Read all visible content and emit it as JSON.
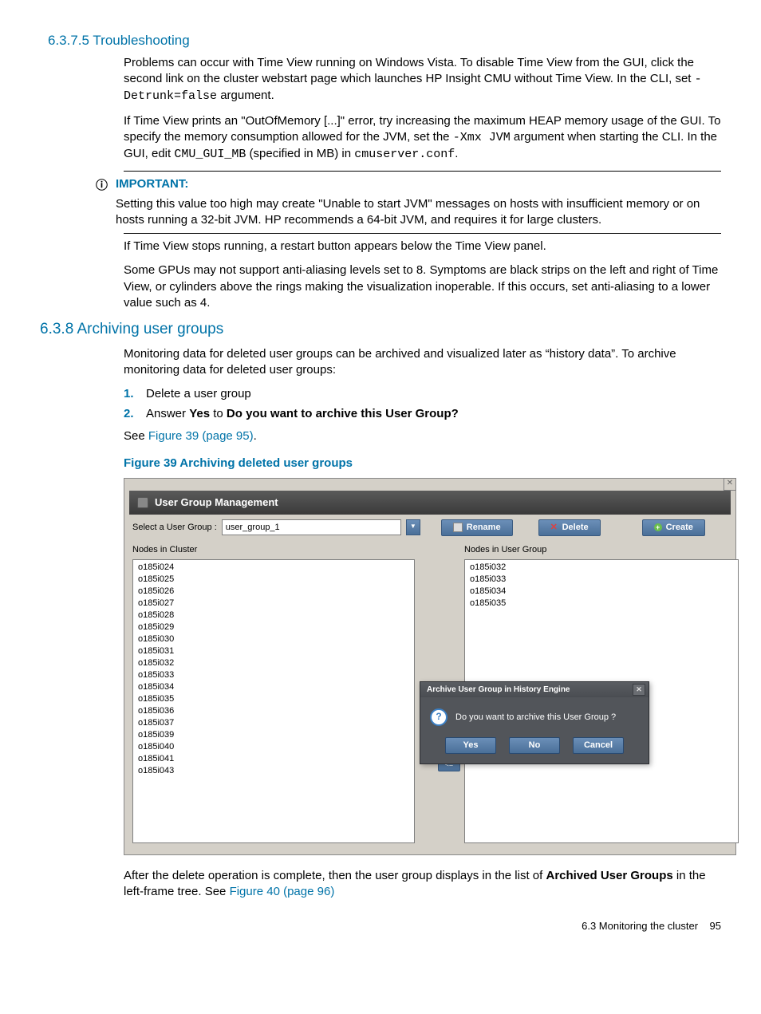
{
  "sec6375": {
    "title": "6.3.7.5 Troubleshooting",
    "p1a": "Problems can occur with Time View running on Windows Vista. To disable Time View from the GUI, click the second link on the cluster webstart page which launches HP Insight CMU without Time View. In the CLI, set ",
    "p1_code": "-Detrunk=false",
    "p1b": " argument.",
    "p2a": "If Time View prints an \"OutOfMemory [...]\" error, try increasing the maximum HEAP memory usage of the GUI. To specify the memory consumption allowed for the JVM, set the ",
    "p2_code1": "-Xmx JVM",
    "p2b": " argument when starting the CLI. In the GUI, edit ",
    "p2_code2": "CMU_GUI_MB",
    "p2c": " (specified in MB) in ",
    "p2_code3": "cmuserver.conf",
    "p2d": ".",
    "important_label": "IMPORTANT:",
    "important_text": "Setting this value too high may create \"Unable to start JVM\" messages on hosts with insufficient memory or on hosts running a 32-bit JVM. HP recommends a 64-bit JVM, and requires it for large clusters.",
    "p3": "If Time View stops running, a restart button appears below the Time View panel.",
    "p4": "Some GPUs may not support anti-aliasing levels set to 8. Symptoms are black strips on the left and right of Time View, or cylinders above the rings making the visualization inoperable. If this occurs, set anti-aliasing to a lower value such as 4."
  },
  "sec638": {
    "title": "6.3.8 Archiving user groups",
    "intro": "Monitoring data for deleted user groups can be archived and visualized later as “history data”. To archive monitoring data for deleted user groups:",
    "li1": "Delete a user group",
    "li2a": "Answer ",
    "li2b": "Yes",
    "li2c": " to ",
    "li2d": "Do you want to archive this User Group?",
    "see_prefix": "See ",
    "see_link": "Figure 39 (page 95)",
    "see_suffix": ".",
    "fig_caption": "Figure 39 Archiving deleted user groups",
    "after_a": "After the delete operation is complete, then the user group displays in the list of ",
    "after_b": "Archived User Groups",
    "after_c": " in the left-frame tree. See ",
    "after_link": "Figure 40 (page 96)"
  },
  "fig": {
    "window_title": "User Group Management",
    "select_label": "Select a User Group :",
    "select_value": "user_group_1",
    "btn_rename": "Rename",
    "btn_delete": "Delete",
    "btn_create": "Create",
    "col_left_label": "Nodes in Cluster",
    "col_right_label": "Nodes in User Group",
    "left_nodes": [
      "o185i024",
      "o185i025",
      "o185i026",
      "o185i027",
      "o185i028",
      "o185i029",
      "o185i030",
      "o185i031",
      "o185i032",
      "o185i033",
      "o185i034",
      "o185i035",
      "o185i036",
      "o185i037",
      "o185i039",
      "o185i040",
      "o185i041",
      "o185i043"
    ],
    "right_nodes": [
      "o185i032",
      "o185i033",
      "o185i034",
      "o185i035"
    ],
    "move_label": "<=",
    "modal": {
      "title": "Archive User Group in History Engine",
      "message": "Do you want to archive this User Group ?",
      "yes": "Yes",
      "no": "No",
      "cancel": "Cancel"
    }
  },
  "footer": {
    "section": "6.3 Monitoring the cluster",
    "page": "95"
  }
}
